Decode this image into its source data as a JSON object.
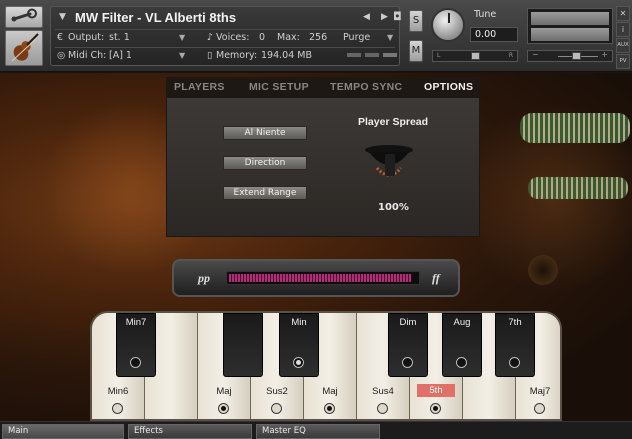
{
  "header": {
    "instrument_title": "MW Filter - VL Alberti 8ths",
    "output_label": "Output:",
    "output_value": "st. 1",
    "voices_label": "Voices:",
    "voices_value": "0",
    "max_label": "Max:",
    "max_value": "256",
    "purge_label": "Purge",
    "midi_label": "Midi Ch:",
    "midi_value": "[A] 1",
    "memory_label": "Memory:",
    "memory_value": "194.04 MB",
    "solo_label": "S",
    "mute_label": "M",
    "tune_label": "Tune",
    "tune_value": "0.00",
    "pan_left": "L",
    "pan_right": "R",
    "aux_label": "AUX",
    "pv_label": "PV"
  },
  "tabs": [
    {
      "label": "PLAYERS",
      "active": false
    },
    {
      "label": "MIC SETUP",
      "active": false
    },
    {
      "label": "TEMPO SYNC",
      "active": false
    },
    {
      "label": "OPTIONS",
      "active": true
    }
  ],
  "options": {
    "al_niente_label": "Al Niente",
    "direction_label": "Direction",
    "extend_range_label": "Extend Range",
    "player_spread_title": "Player Spread",
    "player_spread_value": "100%"
  },
  "dynamics": {
    "low_label": "pp",
    "high_label": "ff",
    "level": 0.97
  },
  "keyboard": {
    "white_keys": [
      {
        "label": "Min6",
        "selected": false,
        "highlight": false
      },
      {
        "label": "",
        "selected": false,
        "highlight": false
      },
      {
        "label": "Maj",
        "selected": true,
        "highlight": false
      },
      {
        "label": "Sus2",
        "selected": false,
        "highlight": false
      },
      {
        "label": "Maj",
        "selected": true,
        "highlight": false
      },
      {
        "label": "Sus4",
        "selected": false,
        "highlight": false
      },
      {
        "label": "5th",
        "selected": true,
        "highlight": true
      },
      {
        "label": "",
        "selected": false,
        "highlight": false
      },
      {
        "label": "Maj7",
        "selected": false,
        "highlight": false
      }
    ],
    "black_keys": [
      {
        "label": "Min7",
        "selected": false
      },
      {
        "label": "",
        "selected": false
      },
      {
        "label": "Min",
        "selected": true
      },
      {
        "label": "Dim",
        "selected": false
      },
      {
        "label": "Aug",
        "selected": false
      },
      {
        "label": "7th",
        "selected": false
      }
    ]
  },
  "bottom_tabs": [
    {
      "label": "Main"
    },
    {
      "label": "Effects"
    },
    {
      "label": "Master EQ"
    }
  ],
  "icons": {
    "wrench": "wrench-icon",
    "violin": "violin-icon",
    "camera": "camera-icon",
    "info": "info-icon",
    "midi": "midi-icon"
  },
  "colors": {
    "velocity_fill": "#b42a76",
    "highlight_key_label": "#e07068",
    "active_tab": "#f4f1ec"
  }
}
